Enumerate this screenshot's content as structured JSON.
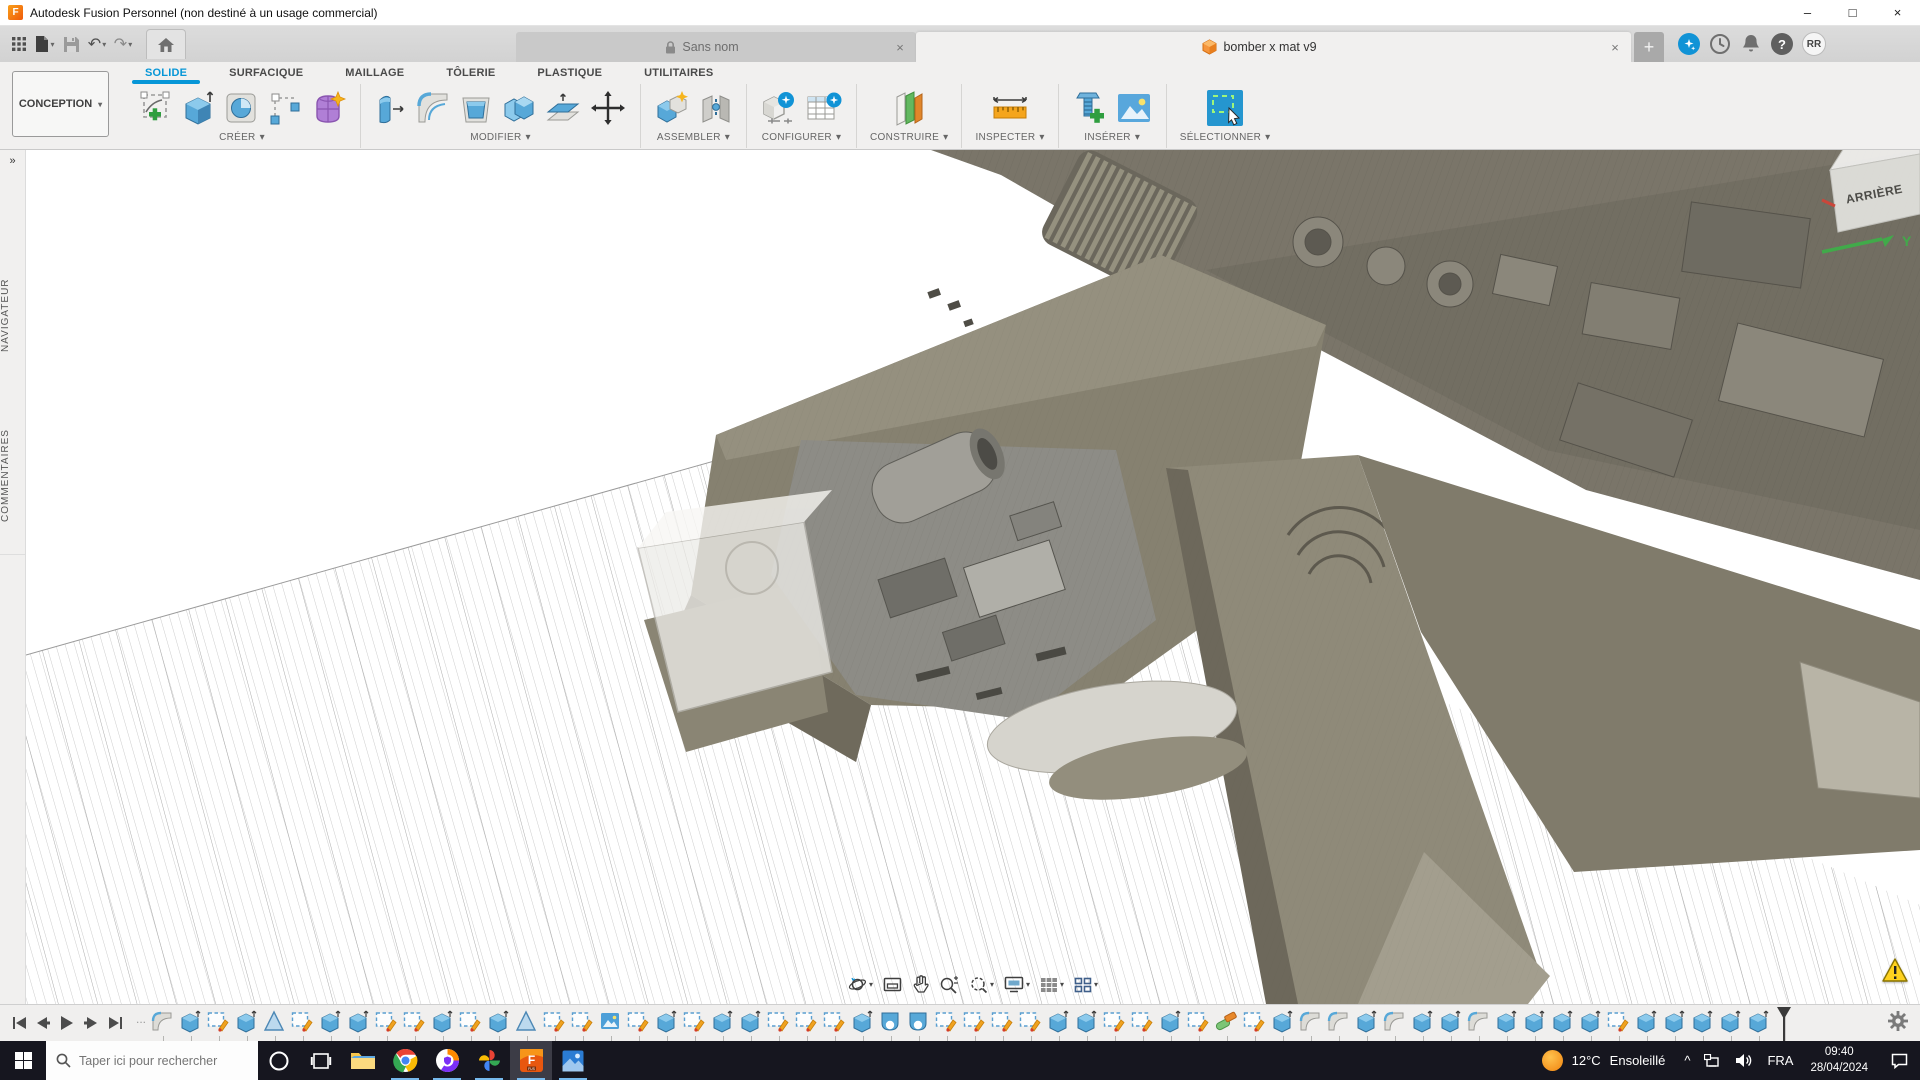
{
  "icons": {
    "caret_down": "▾",
    "chevron_expand": "»",
    "ellipsis": "...",
    "hidden_tray": "^",
    "minimize": "–",
    "maximize": "□",
    "close": "×",
    "new_tab": "+",
    "warning": "warning-triangle",
    "help": "?"
  },
  "colors": {
    "accent_blue": "#0696d7",
    "fusion_orange": "#f1711f",
    "body_tan": "#868170",
    "machinery_gray": "#8d8c86",
    "taskbar_dark": "#16161f",
    "running_indicator": "#76b9ed",
    "warning_yellow": "#f7c71f"
  },
  "title_bar": {
    "title": "Autodesk Fusion Personnel (non destiné à un usage commercial)",
    "app_initial": "F"
  },
  "document_tabs": {
    "tabs": [
      {
        "label": "Sans nom",
        "locked": true,
        "active": false
      },
      {
        "label": "bomber x mat v9",
        "locked": false,
        "active": true
      }
    ]
  },
  "account": {
    "avatar_initials": "RR"
  },
  "ribbon": {
    "workspace_selector": {
      "label": "CONCEPTION"
    },
    "tabs": [
      {
        "label": "SOLIDE",
        "active": true
      },
      {
        "label": "SURFACIQUE",
        "active": false
      },
      {
        "label": "MAILLAGE",
        "active": false
      },
      {
        "label": "TÔLERIE",
        "active": false
      },
      {
        "label": "PLASTIQUE",
        "active": false
      },
      {
        "label": "UTILITAIRES",
        "active": false
      }
    ],
    "groups": [
      {
        "label": "CRÉER",
        "icons": [
          "create-sketch",
          "extrude",
          "revolve",
          "primitive-box",
          "create-form"
        ]
      },
      {
        "label": "MODIFIER",
        "icons": [
          "press-pull",
          "fillet",
          "shell",
          "combine",
          "offset-face",
          "move-copy"
        ]
      },
      {
        "label": "ASSEMBLER",
        "icons": [
          "new-component",
          "joint"
        ]
      },
      {
        "label": "CONFIGURER",
        "icons": [
          "configuration",
          "configuration-table"
        ]
      },
      {
        "label": "CONSTRUIRE",
        "icons": [
          "construction-plane"
        ]
      },
      {
        "label": "INSPECTER",
        "icons": [
          "measure"
        ]
      },
      {
        "label": "INSÉRER",
        "icons": [
          "insert-fastener",
          "insert-canvas"
        ]
      },
      {
        "label": "SÉLECTIONNER",
        "icons": [
          "select"
        ]
      }
    ]
  },
  "side_rail": {
    "panels": [
      {
        "label": "NAVIGATEUR"
      },
      {
        "label": "COMMENTAIRES"
      }
    ]
  },
  "viewport": {
    "viewcube": {
      "visible_face": "ARRIÈRE",
      "axis_label": "Y"
    }
  },
  "nav_bar": {
    "items": [
      {
        "name": "orbit",
        "dropdown": true
      },
      {
        "name": "look-at",
        "dropdown": false
      },
      {
        "name": "pan",
        "dropdown": false
      },
      {
        "name": "zoom",
        "dropdown": false
      },
      {
        "name": "fit",
        "dropdown": true
      },
      {
        "name": "display-settings",
        "dropdown": true
      },
      {
        "name": "grid-layout",
        "dropdown": true
      },
      {
        "name": "viewports",
        "dropdown": true
      }
    ]
  },
  "timeline": {
    "controls": [
      "skip-start",
      "step-back",
      "play",
      "step-forward",
      "skip-end"
    ],
    "items": [
      "fillet",
      "extrude",
      "sketch",
      "extrude",
      "loft",
      "sketch",
      "extrude",
      "extrude",
      "sketch",
      "sketch",
      "extrude",
      "sketch",
      "extrude",
      "loft",
      "sketch",
      "sketch",
      "canvas",
      "sketch",
      "extrude",
      "sketch",
      "extrude",
      "extrude",
      "sketch",
      "sketch",
      "sketch",
      "extrude",
      "revolve",
      "revolve",
      "sketch",
      "sketch",
      "sketch",
      "sketch",
      "extrude",
      "extrude",
      "sketch",
      "sketch",
      "extrude",
      "sketch",
      "combine",
      "sketch",
      "extrude",
      "fillet",
      "fillet",
      "extrude",
      "fillet",
      "extrude",
      "extrude",
      "fillet",
      "extrude",
      "extrude",
      "extrude",
      "extrude",
      "sketch",
      "extrude",
      "extrude",
      "extrude",
      "extrude",
      "extrude"
    ]
  },
  "taskbar": {
    "search": {
      "placeholder": "Taper ici pour rechercher"
    },
    "apps": [
      {
        "name": "cortana",
        "running": false,
        "focused": false
      },
      {
        "name": "task-view",
        "running": false,
        "focused": false
      },
      {
        "name": "file-explorer",
        "running": false,
        "focused": false
      },
      {
        "name": "chrome",
        "running": true,
        "focused": false
      },
      {
        "name": "secure-browser",
        "running": true,
        "focused": false
      },
      {
        "name": "google-photos",
        "running": true,
        "focused": false
      },
      {
        "name": "fusion-360",
        "running": true,
        "focused": true
      },
      {
        "name": "photos",
        "running": true,
        "focused": false
      }
    ],
    "tray": {
      "weather_temp": "12°C",
      "weather_desc": "Ensoleillé",
      "language": "FRA",
      "time": "09:40",
      "date": "28/04/2024"
    }
  }
}
